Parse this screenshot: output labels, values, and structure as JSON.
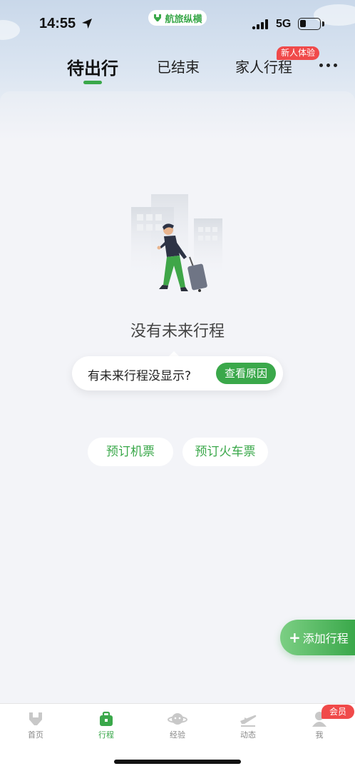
{
  "status_bar": {
    "time": "14:55",
    "network": "5G",
    "brand": "航旅纵横",
    "icons": [
      "location-arrow-icon",
      "signal-icon",
      "battery-icon"
    ]
  },
  "tabs": [
    {
      "label": "待出行",
      "active": true
    },
    {
      "label": "已结束",
      "active": false
    },
    {
      "label": "家人行程",
      "active": false,
      "badge": "新人体验"
    }
  ],
  "empty_state": {
    "title": "没有未来行程",
    "hint_text": "有未来行程没显示?",
    "hint_button": "查看原因"
  },
  "booking": {
    "flight_label": "预订机票",
    "train_label": "预订火车票"
  },
  "fab": {
    "label": "添加行程",
    "icon": "plus-icon"
  },
  "bottom_nav": [
    {
      "label": "首页",
      "icon": "logo-icon",
      "active": false
    },
    {
      "label": "行程",
      "icon": "suitcase-icon",
      "active": true
    },
    {
      "label": "经验",
      "icon": "planet-icon",
      "active": false
    },
    {
      "label": "动态",
      "icon": "flight-icon",
      "active": false
    },
    {
      "label": "我",
      "icon": "user-icon",
      "active": false,
      "badge": "会员"
    }
  ],
  "colors": {
    "accent": "#3aa84a",
    "badge": "#f04a4a",
    "background": "#f3f4f8"
  }
}
